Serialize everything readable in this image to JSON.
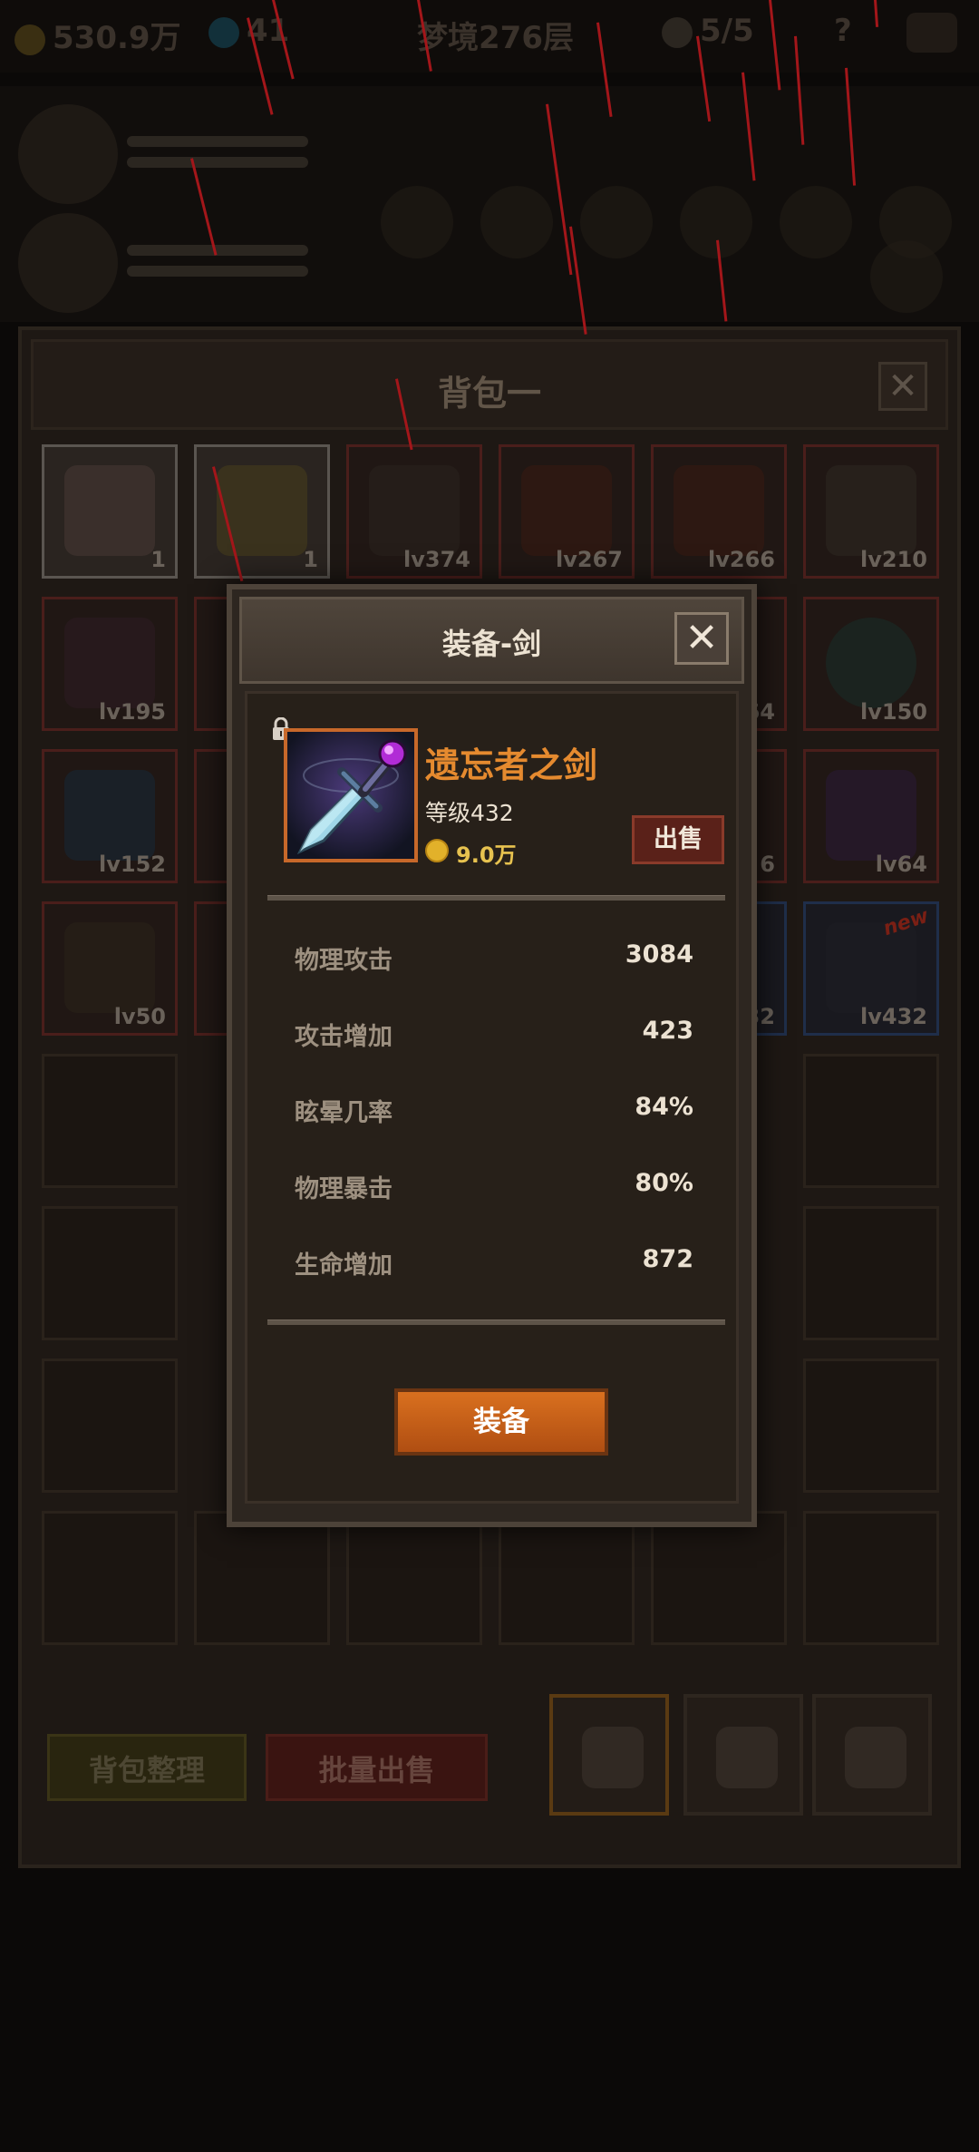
{
  "hud": {
    "gold": "530.9万",
    "gems": "41",
    "dungeon": "梦境276层",
    "keys": "5/5",
    "help": "?"
  },
  "bag": {
    "title": "背包一",
    "close": "✕",
    "slots_row1": [
      "1",
      "1",
      "lv374",
      "lv267",
      "lv266",
      "lv210"
    ],
    "slots_row2": [
      "lv195",
      "",
      "",
      "",
      "64",
      "lv150"
    ],
    "slots_row3": [
      "lv152",
      "",
      "",
      "",
      "6",
      "lv64"
    ],
    "slots_row4": [
      "lv50",
      "",
      "",
      "",
      "32",
      "lv432"
    ],
    "new_badge": "new",
    "sort_button": "背包整理",
    "batch_sell_button": "批量出售"
  },
  "modal": {
    "title": "装备-剑",
    "close": "✕",
    "item": {
      "name": "遗忘者之剑",
      "level": "等级432",
      "price": "9.0万",
      "sell_button": "出售"
    },
    "stats": [
      {
        "label": "物理攻击",
        "value": "3084"
      },
      {
        "label": "攻击增加",
        "value": "423"
      },
      {
        "label": "眩晕几率",
        "value": "84%"
      },
      {
        "label": "物理暴击",
        "value": "80%"
      },
      {
        "label": "生命增加",
        "value": "872"
      }
    ],
    "equip_button": "装备"
  },
  "colors": {
    "accent_orange": "#e58a2f",
    "rain_red": "#a3161a",
    "coin_gold": "#e2b12a"
  }
}
